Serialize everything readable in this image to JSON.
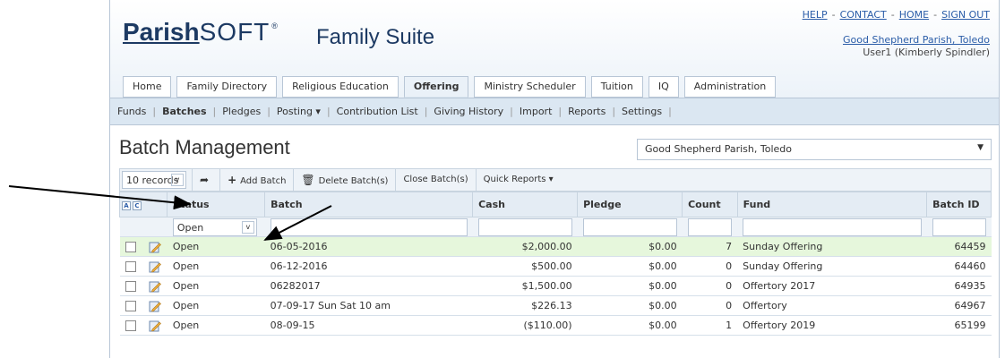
{
  "header": {
    "logo_bold": "Parish",
    "logo_thin": "SOFT",
    "logo_mark": "®",
    "suite_title": "Family Suite",
    "toplinks": [
      "HELP",
      "CONTACT",
      "HOME",
      "SIGN OUT"
    ],
    "parish_name": "Good Shepherd Parish, Toledo",
    "user": "User1 (Kimberly Spindler)"
  },
  "main_tabs": [
    {
      "label": "Home"
    },
    {
      "label": "Family Directory"
    },
    {
      "label": "Religious Education"
    },
    {
      "label": "Offering",
      "active": true
    },
    {
      "label": "Ministry Scheduler"
    },
    {
      "label": "Tuition"
    },
    {
      "label": "IQ"
    },
    {
      "label": "Administration"
    }
  ],
  "sub_nav": [
    {
      "label": "Funds"
    },
    {
      "label": "Batches",
      "active": true
    },
    {
      "label": "Pledges"
    },
    {
      "label": "Posting ▾"
    },
    {
      "label": "Contribution List"
    },
    {
      "label": "Giving History"
    },
    {
      "label": "Import"
    },
    {
      "label": "Reports"
    },
    {
      "label": "Settings"
    }
  ],
  "page_title": "Batch Management",
  "parish_select": "Good Shepherd Parish, Toledo",
  "toolbar": {
    "records": "10 records",
    "add_batch": "Add Batch",
    "delete_batch": "Delete Batch(s)",
    "close_batch": "Close Batch(s)",
    "quick_reports": "Quick Reports ▾"
  },
  "grid": {
    "ac_labels": [
      "A",
      "C"
    ],
    "columns": [
      "Status",
      "Batch",
      "Cash",
      "Pledge",
      "Count",
      "Fund",
      "Batch ID"
    ],
    "status_filter": "Open",
    "rows": [
      {
        "status": "Open",
        "batch": "06-05-2016",
        "cash": "$2,000.00",
        "pledge": "$0.00",
        "count": "7",
        "fund": "Sunday Offering",
        "id": "64459"
      },
      {
        "status": "Open",
        "batch": "06-12-2016",
        "cash": "$500.00",
        "pledge": "$0.00",
        "count": "0",
        "fund": "Sunday Offering",
        "id": "64460"
      },
      {
        "status": "Open",
        "batch": "06282017",
        "cash": "$1,500.00",
        "pledge": "$0.00",
        "count": "0",
        "fund": "Offertory 2017",
        "id": "64935"
      },
      {
        "status": "Open",
        "batch": "07-09-17 Sun Sat 10 am",
        "cash": "$226.13",
        "pledge": "$0.00",
        "count": "0",
        "fund": "Offertory",
        "id": "64967"
      },
      {
        "status": "Open",
        "batch": "08-09-15",
        "cash": "($110.00)",
        "pledge": "$0.00",
        "count": "1",
        "fund": "Offertory 2019",
        "id": "65199"
      }
    ]
  },
  "colors": {
    "link": "#2b5da8",
    "subnav_bg": "#dbe7f2",
    "highlight_row": "#e6f7dc"
  }
}
